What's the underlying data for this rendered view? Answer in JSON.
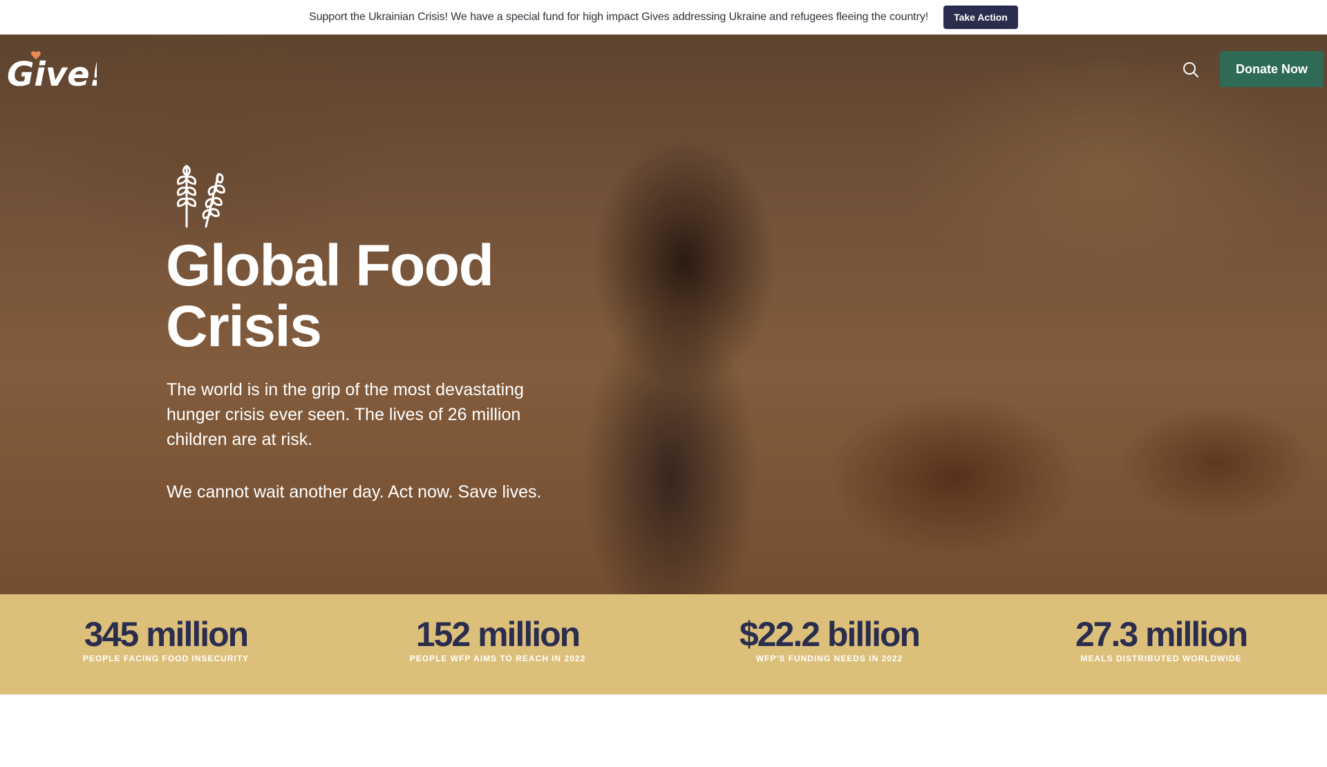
{
  "banner": {
    "text": "Support the Ukrainian Crisis! We have a special fund for high impact Gives addressing Ukraine and refugees fleeing the country!",
    "button_label": "Take Action"
  },
  "header": {
    "logo_text": "Give!",
    "search_icon": "search-icon",
    "donate_label": "Donate Now"
  },
  "hero": {
    "icon": "wheat-icon",
    "title_line1": "Global Food",
    "title_line2": "Crisis",
    "description": "The world is in the grip of the most devastating hunger crisis ever seen. The lives of 26 million children are at risk.",
    "call_to_action": "We cannot wait another day. Act now. Save lives."
  },
  "stats": [
    {
      "value": "345 million",
      "label": "PEOPLE FACING FOOD INSECURITY"
    },
    {
      "value": "152 million",
      "label": "PEOPLE WFP AIMS TO REACH IN 2022"
    },
    {
      "value": "$22.2 billion",
      "label": "WFP'S FUNDING NEEDS IN 2022"
    },
    {
      "value": "27.3 million",
      "label": "MEALS DISTRIBUTED WORLDWIDE"
    }
  ],
  "colors": {
    "brand_green": "#2e6b56",
    "navy": "#2b2d4e",
    "stats_background": "#dcc07a",
    "logo_heart": "#e98a5a"
  }
}
